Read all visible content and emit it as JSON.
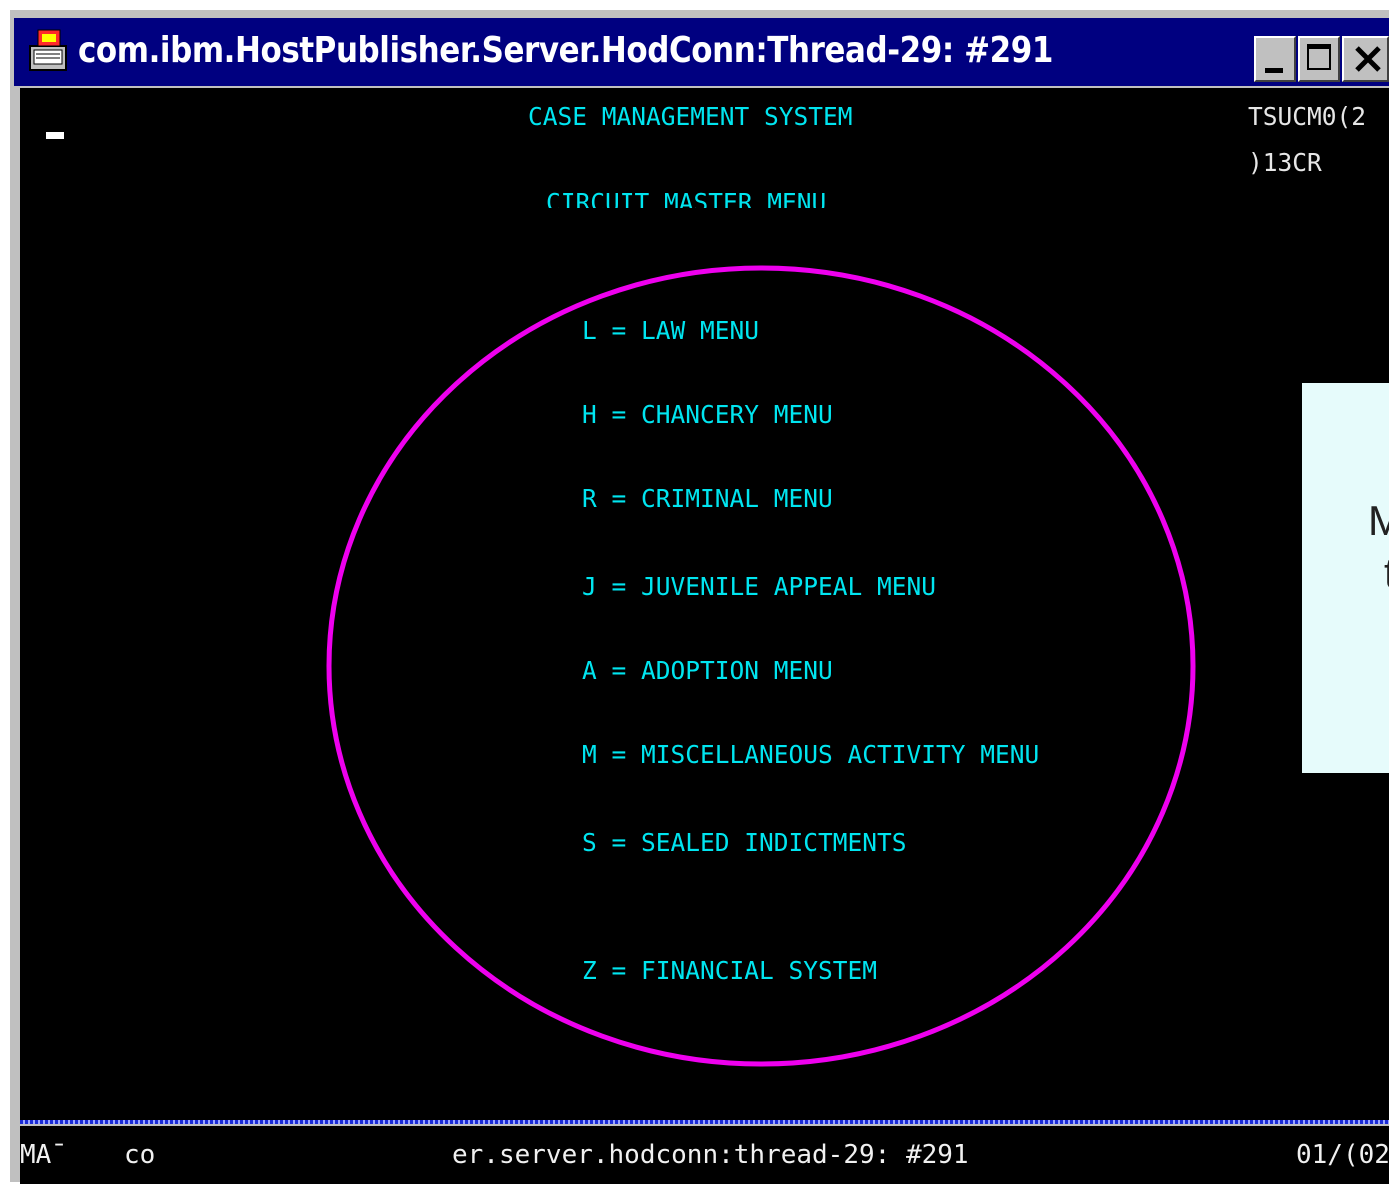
{
  "window": {
    "title": "com.ibm.HostPublisher.Server.HodConn:Thread-29: #291",
    "controls": {
      "minimize": "minimize",
      "maximize": "maximize",
      "close": "close"
    }
  },
  "terminal": {
    "heading": "CASE MANAGEMENT SYSTEM",
    "sub_heading": "CIRCUIT MASTER MENU",
    "screen_code_1": "TSUCM0(2",
    "screen_code_2": ")13CR",
    "menu_options": [
      {
        "label": "L = LAW MENU"
      },
      {
        "label": "H = CHANCERY MENU"
      },
      {
        "label": "R = CRIMINAL MENU"
      },
      {
        "label": "J = JUVENILE APPEAL MENU"
      },
      {
        "label": "A = ADOPTION MENU"
      },
      {
        "label": "M = MISCELLANEOUS ACTIVITY MENU"
      },
      {
        "label": "S = SEALED INDICTMENTS"
      },
      {
        "label": "Z = FINANCIAL SYSTEM"
      }
    ]
  },
  "callout": {
    "line1": "M",
    "line2": "t"
  },
  "status_bar": {
    "mode": "MA¯",
    "indicator": "co",
    "session": "er.server.hodconn:thread-29: #291",
    "cursor_pos": "01/(02"
  },
  "colors": {
    "terminal_text": "#00e5f0",
    "highlight_circle": "#ee00ee",
    "titlebar": "#000080"
  }
}
